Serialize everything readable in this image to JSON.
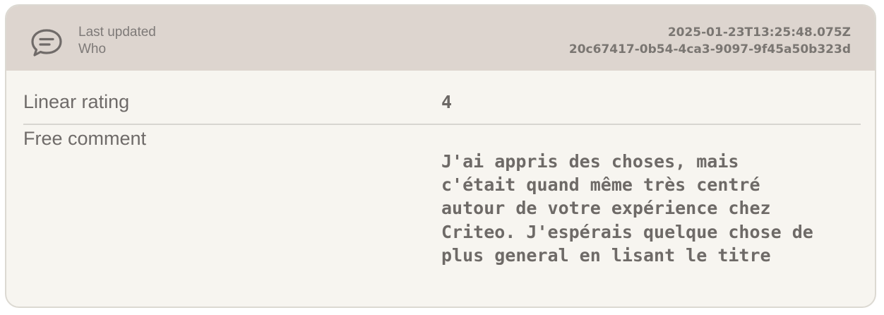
{
  "header": {
    "icon": "chat-bubble-icon",
    "last_updated_label": "Last updated",
    "who_label": "Who",
    "last_updated_value": "2025-01-23T13:25:48.075Z",
    "who_value": "20c67417-0b54-4ca3-9097-9f45a50b323d"
  },
  "fields": {
    "linear_rating": {
      "label": "Linear rating",
      "value": "4"
    },
    "free_comment": {
      "label": "Free comment",
      "value": "J'ai appris des choses, mais\nc'était quand même très centré\nautour de votre expérience chez\nCriteo. J'espérais quelque chose de\nplus general en lisant le titre"
    }
  },
  "colors": {
    "header_background": "#ddd5cf",
    "card_background": "#f7f5f0",
    "border": "#dcd9d2",
    "text": "#6f6b69"
  }
}
